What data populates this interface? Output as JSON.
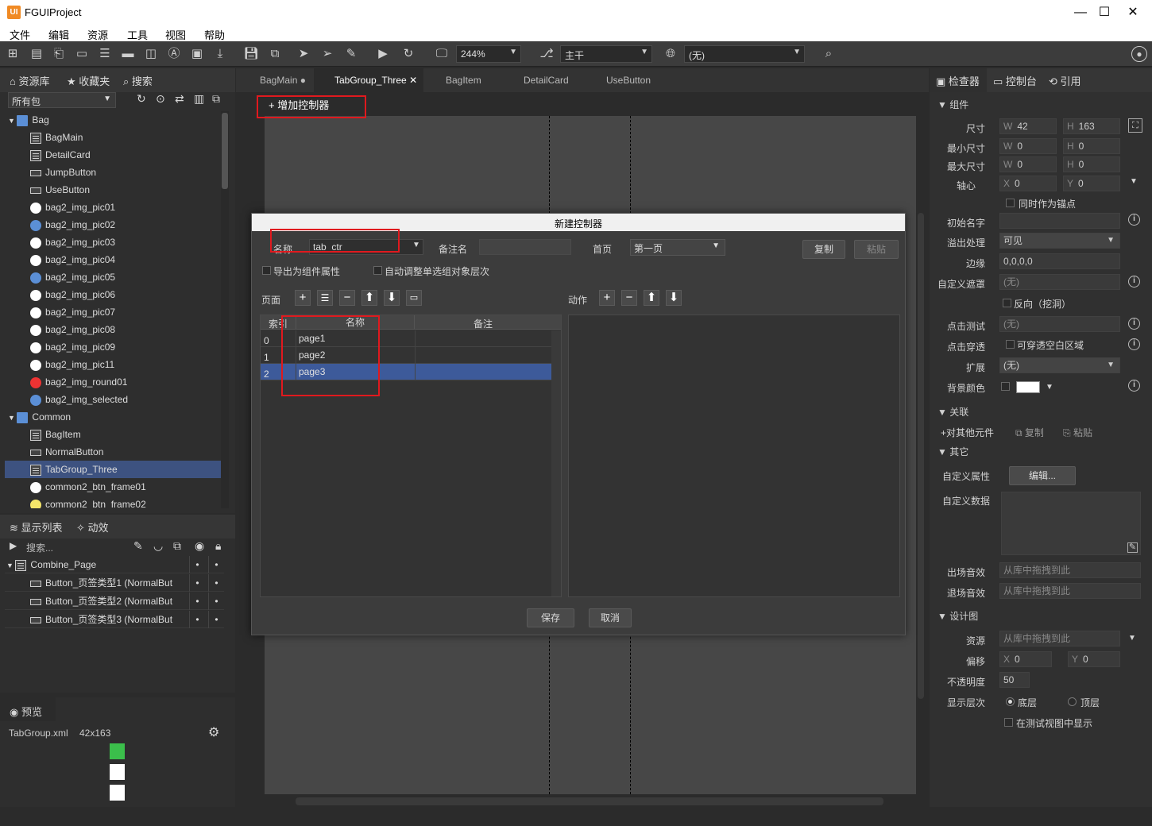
{
  "app": {
    "logo": "UI",
    "title": "FGUIProject"
  },
  "window": {
    "minimize": "—",
    "maximize": "☐",
    "close": "✕"
  },
  "menu": [
    "文件",
    "编辑",
    "资源",
    "工具",
    "视图",
    "帮助"
  ],
  "toolbar": {
    "zoom": "244%",
    "branch": "主干",
    "lang": "(无)"
  },
  "library": {
    "tabs": [
      "资源库",
      "收藏夹",
      "搜索"
    ],
    "package_filter": "所有包",
    "tree": [
      {
        "label": "Bag",
        "kind": "folder",
        "level": 0
      },
      {
        "label": "BagMain",
        "kind": "comp",
        "level": 1
      },
      {
        "label": "DetailCard",
        "kind": "comp",
        "level": 1
      },
      {
        "label": "JumpButton",
        "kind": "btn",
        "level": 1
      },
      {
        "label": "UseButton",
        "kind": "btn",
        "level": 1
      },
      {
        "label": "bag2_img_pic01",
        "kind": "img",
        "level": 1
      },
      {
        "label": "bag2_img_pic02",
        "kind": "img",
        "level": 1
      },
      {
        "label": "bag2_img_pic03",
        "kind": "img",
        "level": 1
      },
      {
        "label": "bag2_img_pic04",
        "kind": "img",
        "level": 1
      },
      {
        "label": "bag2_img_pic05",
        "kind": "img",
        "level": 1
      },
      {
        "label": "bag2_img_pic06",
        "kind": "img",
        "level": 1
      },
      {
        "label": "bag2_img_pic07",
        "kind": "img",
        "level": 1
      },
      {
        "label": "bag2_img_pic08",
        "kind": "img",
        "level": 1
      },
      {
        "label": "bag2_img_pic09",
        "kind": "img",
        "level": 1
      },
      {
        "label": "bag2_img_pic11",
        "kind": "img",
        "level": 1
      },
      {
        "label": "bag2_img_round01",
        "kind": "img",
        "level": 1
      },
      {
        "label": "bag2_img_selected",
        "kind": "img",
        "level": 1
      },
      {
        "label": "Common",
        "kind": "folder",
        "level": 0
      },
      {
        "label": "BagItem",
        "kind": "comp",
        "level": 1
      },
      {
        "label": "NormalButton",
        "kind": "btn",
        "level": 1
      },
      {
        "label": "TabGroup_Three",
        "kind": "comp",
        "level": 1,
        "selected": true
      },
      {
        "label": "common2_btn_frame01",
        "kind": "img",
        "level": 1
      },
      {
        "label": "common2_btn_frame02",
        "kind": "img",
        "level": 1
      }
    ]
  },
  "display_list": {
    "tabs": [
      "显示列表",
      "动效"
    ],
    "search_placeholder": "搜索...",
    "items": [
      {
        "label": "Combine_Page",
        "level": 0
      },
      {
        "label": "Button_页签类型1 (NormalBut",
        "level": 1
      },
      {
        "label": "Button_页签类型2 (NormalBut",
        "level": 1
      },
      {
        "label": "Button_页签类型3 (NormalBut",
        "level": 1
      }
    ],
    "dot": "•"
  },
  "preview": {
    "tab": "预览",
    "file": "TabGroup.xml",
    "size": "42x163"
  },
  "doc_tabs": [
    {
      "label": "BagMain",
      "suffix": "●"
    },
    {
      "label": "TabGroup_Three",
      "suffix": "✕",
      "active": true
    },
    {
      "label": "BagItem",
      "suffix": ""
    },
    {
      "label": "DetailCard",
      "suffix": ""
    },
    {
      "label": "UseButton",
      "suffix": ""
    }
  ],
  "add_controller": "增加控制器",
  "dialog": {
    "title": "新建控制器",
    "name_label": "名称",
    "name_value": "tab_ctr",
    "remark_label": "备注名",
    "remark_value": "",
    "home_label": "首页",
    "home_value": "第一页",
    "copy": "复制",
    "paste": "粘贴",
    "export_label": "导出为组件属性",
    "auto_label": "自动调整单选组对象层次",
    "pages_label": "页面",
    "actions_label": "动作",
    "columns": [
      "索引",
      "名称",
      "备注"
    ],
    "pages": [
      {
        "index": "0",
        "name": "page1",
        "remark": ""
      },
      {
        "index": "1",
        "name": "page2",
        "remark": ""
      },
      {
        "index": "2",
        "name": "page3",
        "remark": "",
        "selected": true
      }
    ],
    "save": "保存",
    "cancel": "取消"
  },
  "inspector": {
    "tabs": [
      "检查器",
      "控制台",
      "引用"
    ],
    "component_section": "组件",
    "size_label": "尺寸",
    "w": "42",
    "h": "163",
    "min_label": "最小尺寸",
    "min_w": "0",
    "min_h": "0",
    "max_label": "最大尺寸",
    "max_w": "0",
    "max_h": "0",
    "pivot_label": "轴心",
    "pivot_x": "0",
    "pivot_y": "0",
    "anchor_label": "同时作为锚点",
    "init_name_label": "初始名字",
    "init_name": "",
    "overflow_label": "溢出处理",
    "overflow": "可见",
    "margin_label": "边缘",
    "margin": "0,0,0,0",
    "mask_label": "自定义遮罩",
    "mask": "(无)",
    "reverse_label": "反向（挖洞）",
    "hit_label": "点击测试",
    "hit": "(无)",
    "passthrough_label": "点击穿透",
    "passthrough_opt": "可穿透空白区域",
    "extend_label": "扩展",
    "extend": "(无)",
    "bgcolor_label": "背景颜色",
    "bgcolor": "#ffffff",
    "relation_section": "关联",
    "rel_add": "+对其他元件",
    "rel_copy": "复制",
    "rel_paste": "粘贴",
    "other_section": "其它",
    "custom_prop_label": "自定义属性",
    "edit_btn": "编辑...",
    "custom_data_label": "自定义数据",
    "enter_sound_label": "出场音效",
    "enter_sound": "从库中拖拽到此",
    "exit_sound_label": "退场音效",
    "exit_sound": "从库中拖拽到此",
    "design_section": "设计图",
    "res_label": "资源",
    "res": "从库中拖拽到此",
    "offset_label": "偏移",
    "off_x": "0",
    "off_y": "0",
    "opacity_label": "不透明度",
    "opacity": "50",
    "layer_label": "显示层次",
    "layer_bottom": "底层",
    "layer_top": "顶层",
    "test_view_label": "在测试视图中显示"
  }
}
